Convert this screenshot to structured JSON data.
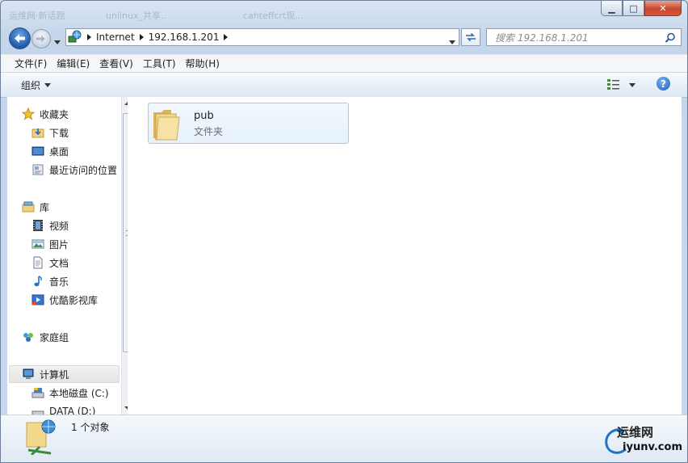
{
  "titlebar": {
    "ghost_tabs": [
      "运维网·新话题",
      "unlinux_共享..",
      "cahteffcrt现..."
    ],
    "minimize": "▁",
    "maximize": "□",
    "close": "✕"
  },
  "address": {
    "root": "Internet",
    "host": "192.168.1.201"
  },
  "search": {
    "placeholder": "搜索 192.168.1.201"
  },
  "menu": [
    "文件(F)",
    "编辑(E)",
    "查看(V)",
    "工具(T)",
    "帮助(H)"
  ],
  "toolbar": {
    "organize": "组织",
    "help": "?"
  },
  "nav": {
    "favorites": "收藏夹",
    "downloads": "下载",
    "desktop": "桌面",
    "recent": "最近访问的位置",
    "libraries": "库",
    "videos": "视频",
    "pictures": "图片",
    "documents": "文档",
    "music": "音乐",
    "youku": "优酷影视库",
    "homegroup": "家庭组",
    "computer": "计算机",
    "local_disk": "本地磁盘 (C:)",
    "data_disk": "DATA (D:)"
  },
  "items": [
    {
      "name": "pub",
      "type": "文件夹"
    }
  ],
  "status": {
    "count": "1 个对象"
  },
  "watermark": {
    "cn": "运维网",
    "url": "iyunv.com"
  },
  "colors": {
    "accent": "#1e73c8",
    "folder": "#f1d27a",
    "selection": "#a5cdeb"
  }
}
